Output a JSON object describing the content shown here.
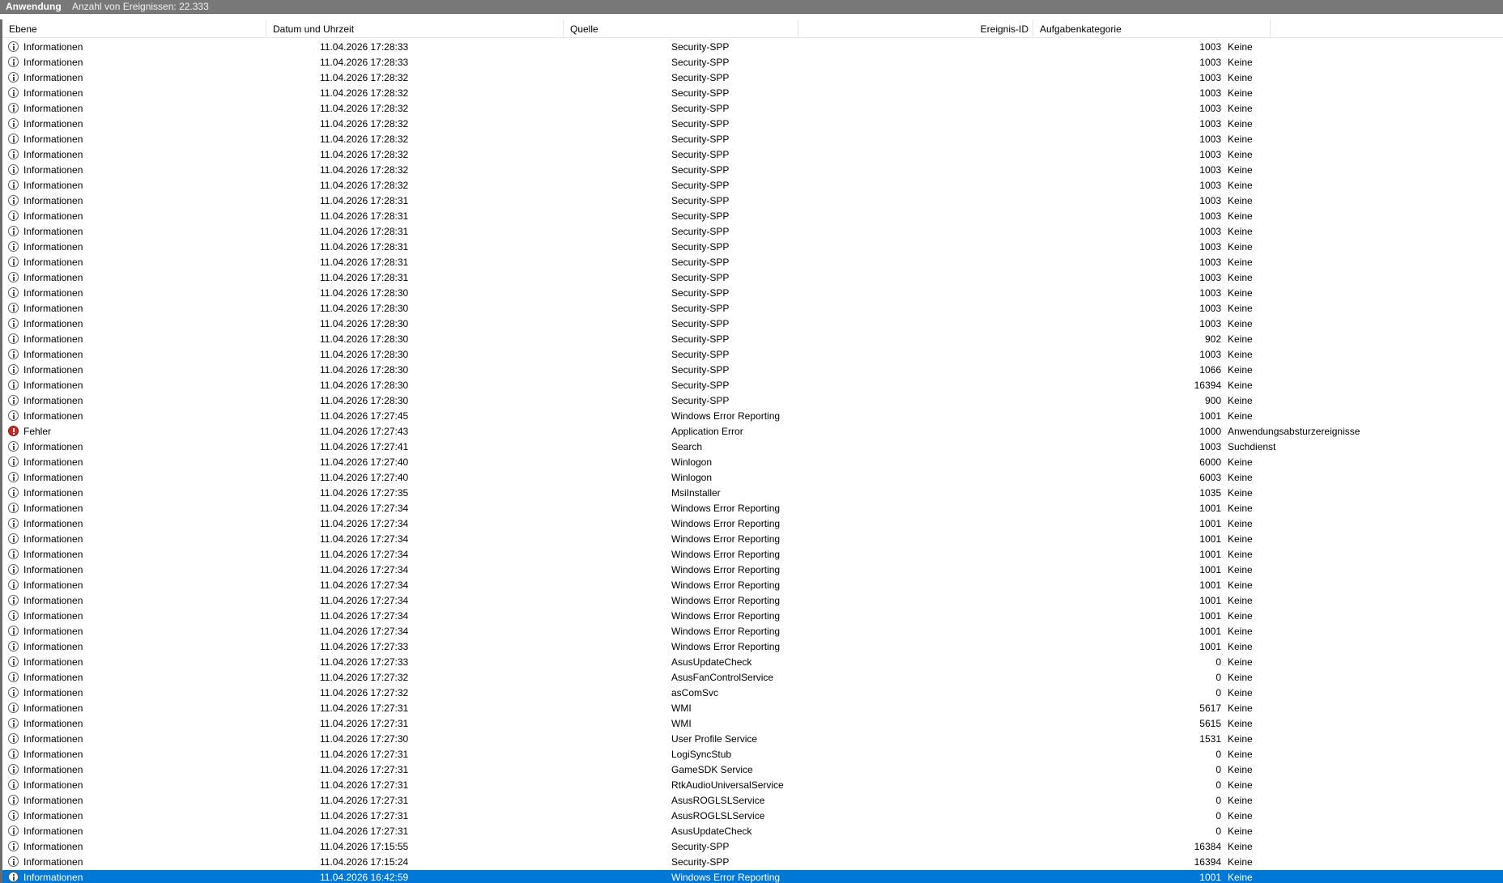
{
  "titlebar": {
    "title": "Anwendung",
    "count_text": "Anzahl von Ereignissen: 22.333"
  },
  "columns": {
    "level": "Ebene",
    "date": "Datum und Uhrzeit",
    "source": "Quelle",
    "event_id": "Ereignis-ID",
    "category": "Aufgabenkategorie"
  },
  "icons": {
    "info": "info-icon",
    "error": "error-icon"
  },
  "colors": {
    "selection": "#0078d7",
    "titlebar": "#787878",
    "error": "#c62828"
  },
  "rows": [
    {
      "level": "Informationen",
      "icon": "info",
      "date": "11.04.2026 17:28:33",
      "source": "Security-SPP",
      "id": "1003",
      "category": "Keine"
    },
    {
      "level": "Informationen",
      "icon": "info",
      "date": "11.04.2026 17:28:33",
      "source": "Security-SPP",
      "id": "1003",
      "category": "Keine"
    },
    {
      "level": "Informationen",
      "icon": "info",
      "date": "11.04.2026 17:28:32",
      "source": "Security-SPP",
      "id": "1003",
      "category": "Keine"
    },
    {
      "level": "Informationen",
      "icon": "info",
      "date": "11.04.2026 17:28:32",
      "source": "Security-SPP",
      "id": "1003",
      "category": "Keine"
    },
    {
      "level": "Informationen",
      "icon": "info",
      "date": "11.04.2026 17:28:32",
      "source": "Security-SPP",
      "id": "1003",
      "category": "Keine"
    },
    {
      "level": "Informationen",
      "icon": "info",
      "date": "11.04.2026 17:28:32",
      "source": "Security-SPP",
      "id": "1003",
      "category": "Keine"
    },
    {
      "level": "Informationen",
      "icon": "info",
      "date": "11.04.2026 17:28:32",
      "source": "Security-SPP",
      "id": "1003",
      "category": "Keine"
    },
    {
      "level": "Informationen",
      "icon": "info",
      "date": "11.04.2026 17:28:32",
      "source": "Security-SPP",
      "id": "1003",
      "category": "Keine"
    },
    {
      "level": "Informationen",
      "icon": "info",
      "date": "11.04.2026 17:28:32",
      "source": "Security-SPP",
      "id": "1003",
      "category": "Keine"
    },
    {
      "level": "Informationen",
      "icon": "info",
      "date": "11.04.2026 17:28:32",
      "source": "Security-SPP",
      "id": "1003",
      "category": "Keine"
    },
    {
      "level": "Informationen",
      "icon": "info",
      "date": "11.04.2026 17:28:31",
      "source": "Security-SPP",
      "id": "1003",
      "category": "Keine"
    },
    {
      "level": "Informationen",
      "icon": "info",
      "date": "11.04.2026 17:28:31",
      "source": "Security-SPP",
      "id": "1003",
      "category": "Keine"
    },
    {
      "level": "Informationen",
      "icon": "info",
      "date": "11.04.2026 17:28:31",
      "source": "Security-SPP",
      "id": "1003",
      "category": "Keine"
    },
    {
      "level": "Informationen",
      "icon": "info",
      "date": "11.04.2026 17:28:31",
      "source": "Security-SPP",
      "id": "1003",
      "category": "Keine"
    },
    {
      "level": "Informationen",
      "icon": "info",
      "date": "11.04.2026 17:28:31",
      "source": "Security-SPP",
      "id": "1003",
      "category": "Keine"
    },
    {
      "level": "Informationen",
      "icon": "info",
      "date": "11.04.2026 17:28:31",
      "source": "Security-SPP",
      "id": "1003",
      "category": "Keine"
    },
    {
      "level": "Informationen",
      "icon": "info",
      "date": "11.04.2026 17:28:30",
      "source": "Security-SPP",
      "id": "1003",
      "category": "Keine"
    },
    {
      "level": "Informationen",
      "icon": "info",
      "date": "11.04.2026 17:28:30",
      "source": "Security-SPP",
      "id": "1003",
      "category": "Keine"
    },
    {
      "level": "Informationen",
      "icon": "info",
      "date": "11.04.2026 17:28:30",
      "source": "Security-SPP",
      "id": "1003",
      "category": "Keine"
    },
    {
      "level": "Informationen",
      "icon": "info",
      "date": "11.04.2026 17:28:30",
      "source": "Security-SPP",
      "id": "902",
      "category": "Keine"
    },
    {
      "level": "Informationen",
      "icon": "info",
      "date": "11.04.2026 17:28:30",
      "source": "Security-SPP",
      "id": "1003",
      "category": "Keine"
    },
    {
      "level": "Informationen",
      "icon": "info",
      "date": "11.04.2026 17:28:30",
      "source": "Security-SPP",
      "id": "1066",
      "category": "Keine"
    },
    {
      "level": "Informationen",
      "icon": "info",
      "date": "11.04.2026 17:28:30",
      "source": "Security-SPP",
      "id": "16394",
      "category": "Keine"
    },
    {
      "level": "Informationen",
      "icon": "info",
      "date": "11.04.2026 17:28:30",
      "source": "Security-SPP",
      "id": "900",
      "category": "Keine"
    },
    {
      "level": "Informationen",
      "icon": "info",
      "date": "11.04.2026 17:27:45",
      "source": "Windows Error Reporting",
      "id": "1001",
      "category": "Keine"
    },
    {
      "level": "Fehler",
      "icon": "error",
      "date": "11.04.2026 17:27:43",
      "source": "Application Error",
      "id": "1000",
      "category": "Anwendungsabsturzereignisse"
    },
    {
      "level": "Informationen",
      "icon": "info",
      "date": "11.04.2026 17:27:41",
      "source": "Search",
      "id": "1003",
      "category": "Suchdienst"
    },
    {
      "level": "Informationen",
      "icon": "info",
      "date": "11.04.2026 17:27:40",
      "source": "Winlogon",
      "id": "6000",
      "category": "Keine"
    },
    {
      "level": "Informationen",
      "icon": "info",
      "date": "11.04.2026 17:27:40",
      "source": "Winlogon",
      "id": "6003",
      "category": "Keine"
    },
    {
      "level": "Informationen",
      "icon": "info",
      "date": "11.04.2026 17:27:35",
      "source": "MsiInstaller",
      "id": "1035",
      "category": "Keine"
    },
    {
      "level": "Informationen",
      "icon": "info",
      "date": "11.04.2026 17:27:34",
      "source": "Windows Error Reporting",
      "id": "1001",
      "category": "Keine"
    },
    {
      "level": "Informationen",
      "icon": "info",
      "date": "11.04.2026 17:27:34",
      "source": "Windows Error Reporting",
      "id": "1001",
      "category": "Keine"
    },
    {
      "level": "Informationen",
      "icon": "info",
      "date": "11.04.2026 17:27:34",
      "source": "Windows Error Reporting",
      "id": "1001",
      "category": "Keine"
    },
    {
      "level": "Informationen",
      "icon": "info",
      "date": "11.04.2026 17:27:34",
      "source": "Windows Error Reporting",
      "id": "1001",
      "category": "Keine"
    },
    {
      "level": "Informationen",
      "icon": "info",
      "date": "11.04.2026 17:27:34",
      "source": "Windows Error Reporting",
      "id": "1001",
      "category": "Keine"
    },
    {
      "level": "Informationen",
      "icon": "info",
      "date": "11.04.2026 17:27:34",
      "source": "Windows Error Reporting",
      "id": "1001",
      "category": "Keine"
    },
    {
      "level": "Informationen",
      "icon": "info",
      "date": "11.04.2026 17:27:34",
      "source": "Windows Error Reporting",
      "id": "1001",
      "category": "Keine"
    },
    {
      "level": "Informationen",
      "icon": "info",
      "date": "11.04.2026 17:27:34",
      "source": "Windows Error Reporting",
      "id": "1001",
      "category": "Keine"
    },
    {
      "level": "Informationen",
      "icon": "info",
      "date": "11.04.2026 17:27:34",
      "source": "Windows Error Reporting",
      "id": "1001",
      "category": "Keine"
    },
    {
      "level": "Informationen",
      "icon": "info",
      "date": "11.04.2026 17:27:33",
      "source": "Windows Error Reporting",
      "id": "1001",
      "category": "Keine"
    },
    {
      "level": "Informationen",
      "icon": "info",
      "date": "11.04.2026 17:27:33",
      "source": "AsusUpdateCheck",
      "id": "0",
      "category": "Keine"
    },
    {
      "level": "Informationen",
      "icon": "info",
      "date": "11.04.2026 17:27:32",
      "source": "AsusFanControlService",
      "id": "0",
      "category": "Keine"
    },
    {
      "level": "Informationen",
      "icon": "info",
      "date": "11.04.2026 17:27:32",
      "source": "asComSvc",
      "id": "0",
      "category": "Keine"
    },
    {
      "level": "Informationen",
      "icon": "info",
      "date": "11.04.2026 17:27:31",
      "source": "WMI",
      "id": "5617",
      "category": "Keine"
    },
    {
      "level": "Informationen",
      "icon": "info",
      "date": "11.04.2026 17:27:31",
      "source": "WMI",
      "id": "5615",
      "category": "Keine"
    },
    {
      "level": "Informationen",
      "icon": "info",
      "date": "11.04.2026 17:27:30",
      "source": "User Profile Service",
      "id": "1531",
      "category": "Keine"
    },
    {
      "level": "Informationen",
      "icon": "info",
      "date": "11.04.2026 17:27:31",
      "source": "LogiSyncStub",
      "id": "0",
      "category": "Keine"
    },
    {
      "level": "Informationen",
      "icon": "info",
      "date": "11.04.2026 17:27:31",
      "source": "GameSDK Service",
      "id": "0",
      "category": "Keine"
    },
    {
      "level": "Informationen",
      "icon": "info",
      "date": "11.04.2026 17:27:31",
      "source": "RtkAudioUniversalService",
      "id": "0",
      "category": "Keine"
    },
    {
      "level": "Informationen",
      "icon": "info",
      "date": "11.04.2026 17:27:31",
      "source": "AsusROGLSLService",
      "id": "0",
      "category": "Keine"
    },
    {
      "level": "Informationen",
      "icon": "info",
      "date": "11.04.2026 17:27:31",
      "source": "AsusROGLSLService",
      "id": "0",
      "category": "Keine"
    },
    {
      "level": "Informationen",
      "icon": "info",
      "date": "11.04.2026 17:27:31",
      "source": "AsusUpdateCheck",
      "id": "0",
      "category": "Keine"
    },
    {
      "level": "Informationen",
      "icon": "info",
      "date": "11.04.2026 17:15:55",
      "source": "Security-SPP",
      "id": "16384",
      "category": "Keine"
    },
    {
      "level": "Informationen",
      "icon": "info",
      "date": "11.04.2026 17:15:24",
      "source": "Security-SPP",
      "id": "16394",
      "category": "Keine"
    },
    {
      "level": "Informationen",
      "icon": "info",
      "date": "11.04.2026 16:42:59",
      "source": "Windows Error Reporting",
      "id": "1001",
      "category": "Keine",
      "selected": true
    }
  ]
}
